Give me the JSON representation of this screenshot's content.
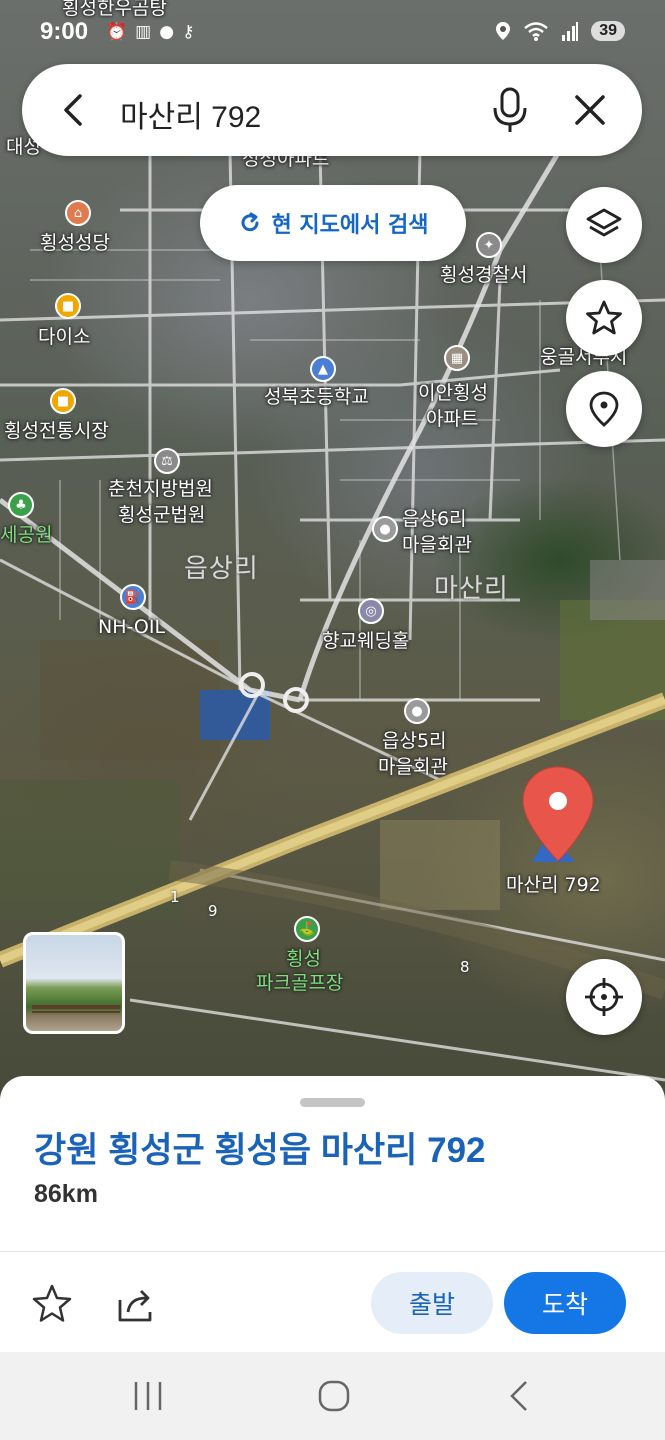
{
  "status_bar": {
    "time": "9:00",
    "battery": "39",
    "icons": [
      "alarm-icon",
      "dnd-icon",
      "app-icon",
      "key-icon",
      "location-icon",
      "wifi-icon",
      "signal-icon"
    ]
  },
  "search": {
    "query": "마산리 792"
  },
  "research_button": {
    "label": "현 지도에서 검색"
  },
  "map": {
    "labels": {
      "top_cut": "횡성한우곰탕",
      "left_cut": "대성",
      "cut_apt": "성성아파트",
      "church": "횡성성당",
      "police": "횡성경찰서",
      "daiso": "다이소",
      "ung": "웅골서루지",
      "school": "성북초등학교",
      "apt1": "이안횡성",
      "apt2": "아파트",
      "market": "횡성전통시장",
      "court1": "춘천지방법원",
      "court2": "횡성군법원",
      "hall6_1": "읍상6리",
      "hall6_2": "마을회관",
      "park_left": "세공원",
      "eupsang": "읍상리",
      "masan": "마산리",
      "nhoil": "NH-OIL",
      "wedding": "향교웨딩홀",
      "hall5_1": "읍상5리",
      "hall5_2": "마을회관",
      "pin_label": "마산리 792",
      "golf1": "횡성",
      "golf2": "파크골프장",
      "n1": "1",
      "n9": "9",
      "n8": "8"
    }
  },
  "place": {
    "address": "강원 횡성군 횡성읍 마산리 792",
    "distance": "86km"
  },
  "actions": {
    "depart": "출발",
    "arrive": "도착"
  },
  "colors": {
    "accent": "#1577e6",
    "title_blue": "#1a63b8",
    "pin_red": "#e8554a"
  }
}
